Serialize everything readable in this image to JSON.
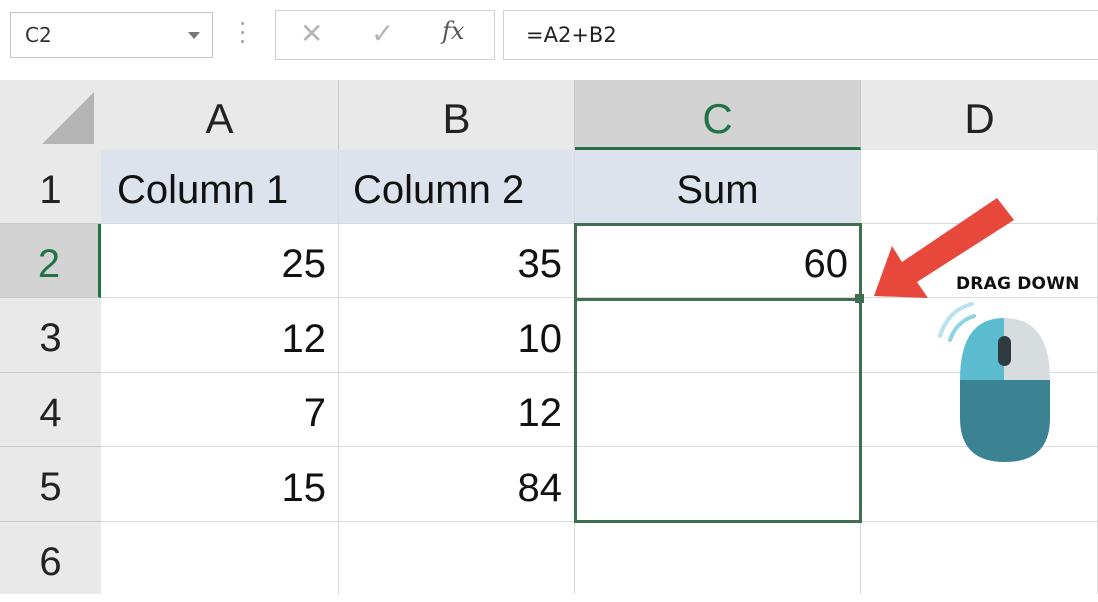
{
  "name_box": {
    "value": "C2"
  },
  "formula_bar": {
    "fx_label": "fx",
    "value": "=A2+B2"
  },
  "columns": [
    "A",
    "B",
    "C",
    "D"
  ],
  "selected_column": "C",
  "rows": [
    "1",
    "2",
    "3",
    "4",
    "5",
    "6"
  ],
  "selected_row": "2",
  "cells": {
    "A1": "Column 1",
    "B1": "Column 2",
    "C1": "Sum",
    "A2": "25",
    "B2": "35",
    "C2": "60",
    "A3": "12",
    "B3": "10",
    "A4": "7",
    "B4": "12",
    "A5": "15",
    "B5": "84"
  },
  "colors": {
    "selection": "#3f6f4f",
    "selected_header_text": "#217346",
    "header_row_fill": "#dde3ed",
    "annotation_arrow": "#e8473c",
    "mouse_left": "#5bbccf",
    "mouse_body": "#3b8292"
  },
  "annotation": {
    "label": "DRAG DOWN",
    "icon": "computer-mouse-icon"
  }
}
